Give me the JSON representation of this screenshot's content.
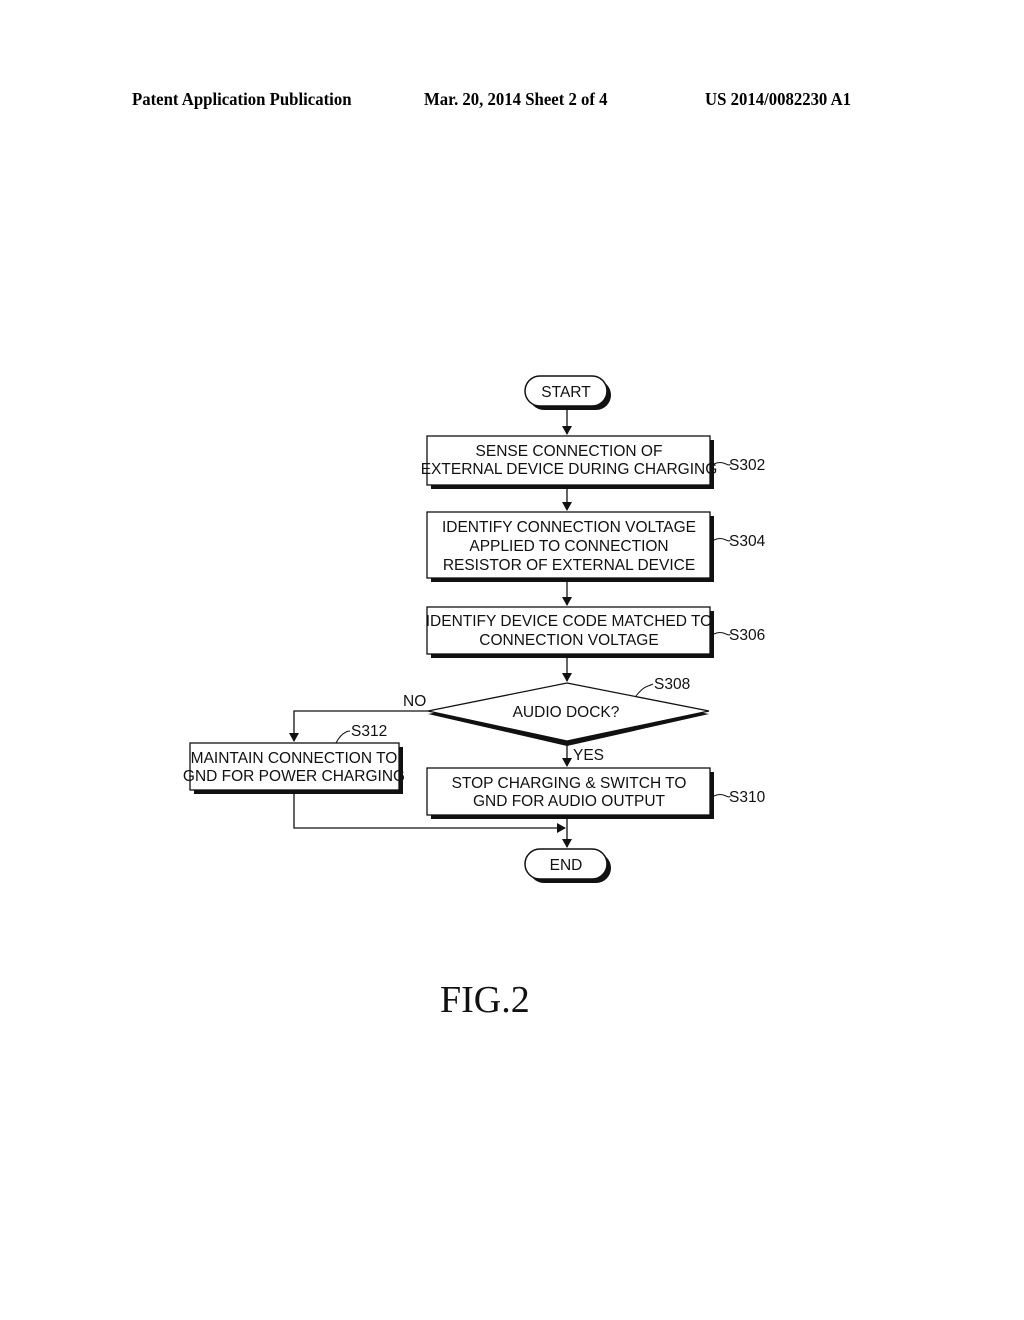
{
  "header": {
    "left": "Patent Application Publication",
    "middle": "Mar. 20, 2014  Sheet 2 of 4",
    "right": "US 2014/0082230 A1"
  },
  "flowchart": {
    "start": "START",
    "end": "END",
    "steps": {
      "s302": {
        "id": "S302",
        "lines": [
          "SENSE CONNECTION OF",
          "EXTERNAL DEVICE DURING CHARGING"
        ]
      },
      "s304": {
        "id": "S304",
        "lines": [
          "IDENTIFY CONNECTION VOLTAGE",
          "APPLIED TO CONNECTION",
          "RESISTOR OF EXTERNAL DEVICE"
        ]
      },
      "s306": {
        "id": "S306",
        "lines": [
          "IDENTIFY DEVICE CODE MATCHED TO",
          "CONNECTION VOLTAGE"
        ]
      },
      "s308": {
        "id": "S308",
        "lines": [
          "AUDIO DOCK?"
        ]
      },
      "s310": {
        "id": "S310",
        "lines": [
          "STOP CHARGING & SWITCH TO",
          "GND FOR AUDIO OUTPUT"
        ]
      },
      "s312": {
        "id": "S312",
        "lines": [
          "MAINTAIN CONNECTION TO",
          "GND FOR POWER CHARGING"
        ]
      }
    },
    "branch_no": "NO",
    "branch_yes": "YES"
  },
  "figure_label": "FIG.2"
}
